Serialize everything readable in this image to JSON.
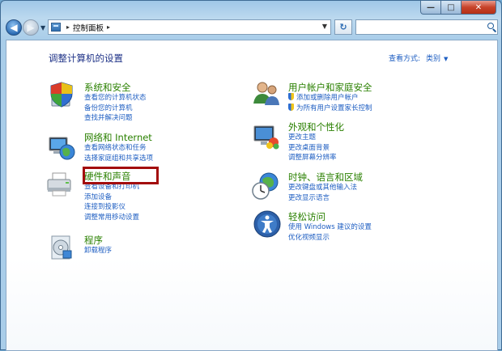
{
  "window": {
    "min_label": "—",
    "max_label": "□",
    "close_label": "✕"
  },
  "nav": {
    "back_icon": "arrow-left-icon",
    "forward_icon": "arrow-right-icon",
    "breadcrumb": "控制面板",
    "breadcrumb_sep": "▸",
    "search_placeholder": ""
  },
  "header": {
    "title": "调整计算机的设置",
    "view_label": "查看方式:",
    "view_value": "类别"
  },
  "categories_left": [
    {
      "title": "系统和安全",
      "icon": "shield-computer-icon",
      "links": [
        "查看您的计算机状态",
        "备份您的计算机",
        "查找并解决问题"
      ]
    },
    {
      "title": "网络和 Internet",
      "icon": "network-globe-icon",
      "links": [
        "查看网络状态和任务",
        "选择家庭组和共享选项"
      ]
    },
    {
      "title": "硬件和声音",
      "icon": "printer-icon",
      "links": [
        "查看设备和打印机",
        "添加设备",
        "连接到投影仪",
        "调整常用移动设置"
      ]
    },
    {
      "title": "程序",
      "icon": "programs-icon",
      "links": [
        "卸载程序"
      ]
    }
  ],
  "categories_right": [
    {
      "title": "用户帐户和家庭安全",
      "icon": "users-icon",
      "links": [
        "添加或删除用户帐户",
        "为所有用户设置家长控制"
      ]
    },
    {
      "title": "外观和个性化",
      "icon": "monitor-paint-icon",
      "links": [
        "更改主题",
        "更改桌面背景",
        "调整屏幕分辨率"
      ]
    },
    {
      "title": "时钟、语言和区域",
      "icon": "clock-globe-icon",
      "links": [
        "更改键盘或其他输入法",
        "更改显示语言"
      ]
    },
    {
      "title": "轻松访问",
      "icon": "ease-of-access-icon",
      "links": [
        "使用 Windows 建议的设置",
        "优化视频显示"
      ]
    }
  ],
  "colors": {
    "title_green": "#2a8000",
    "link_blue": "#1e5ec2",
    "highlight_red": "#a30d0d"
  }
}
